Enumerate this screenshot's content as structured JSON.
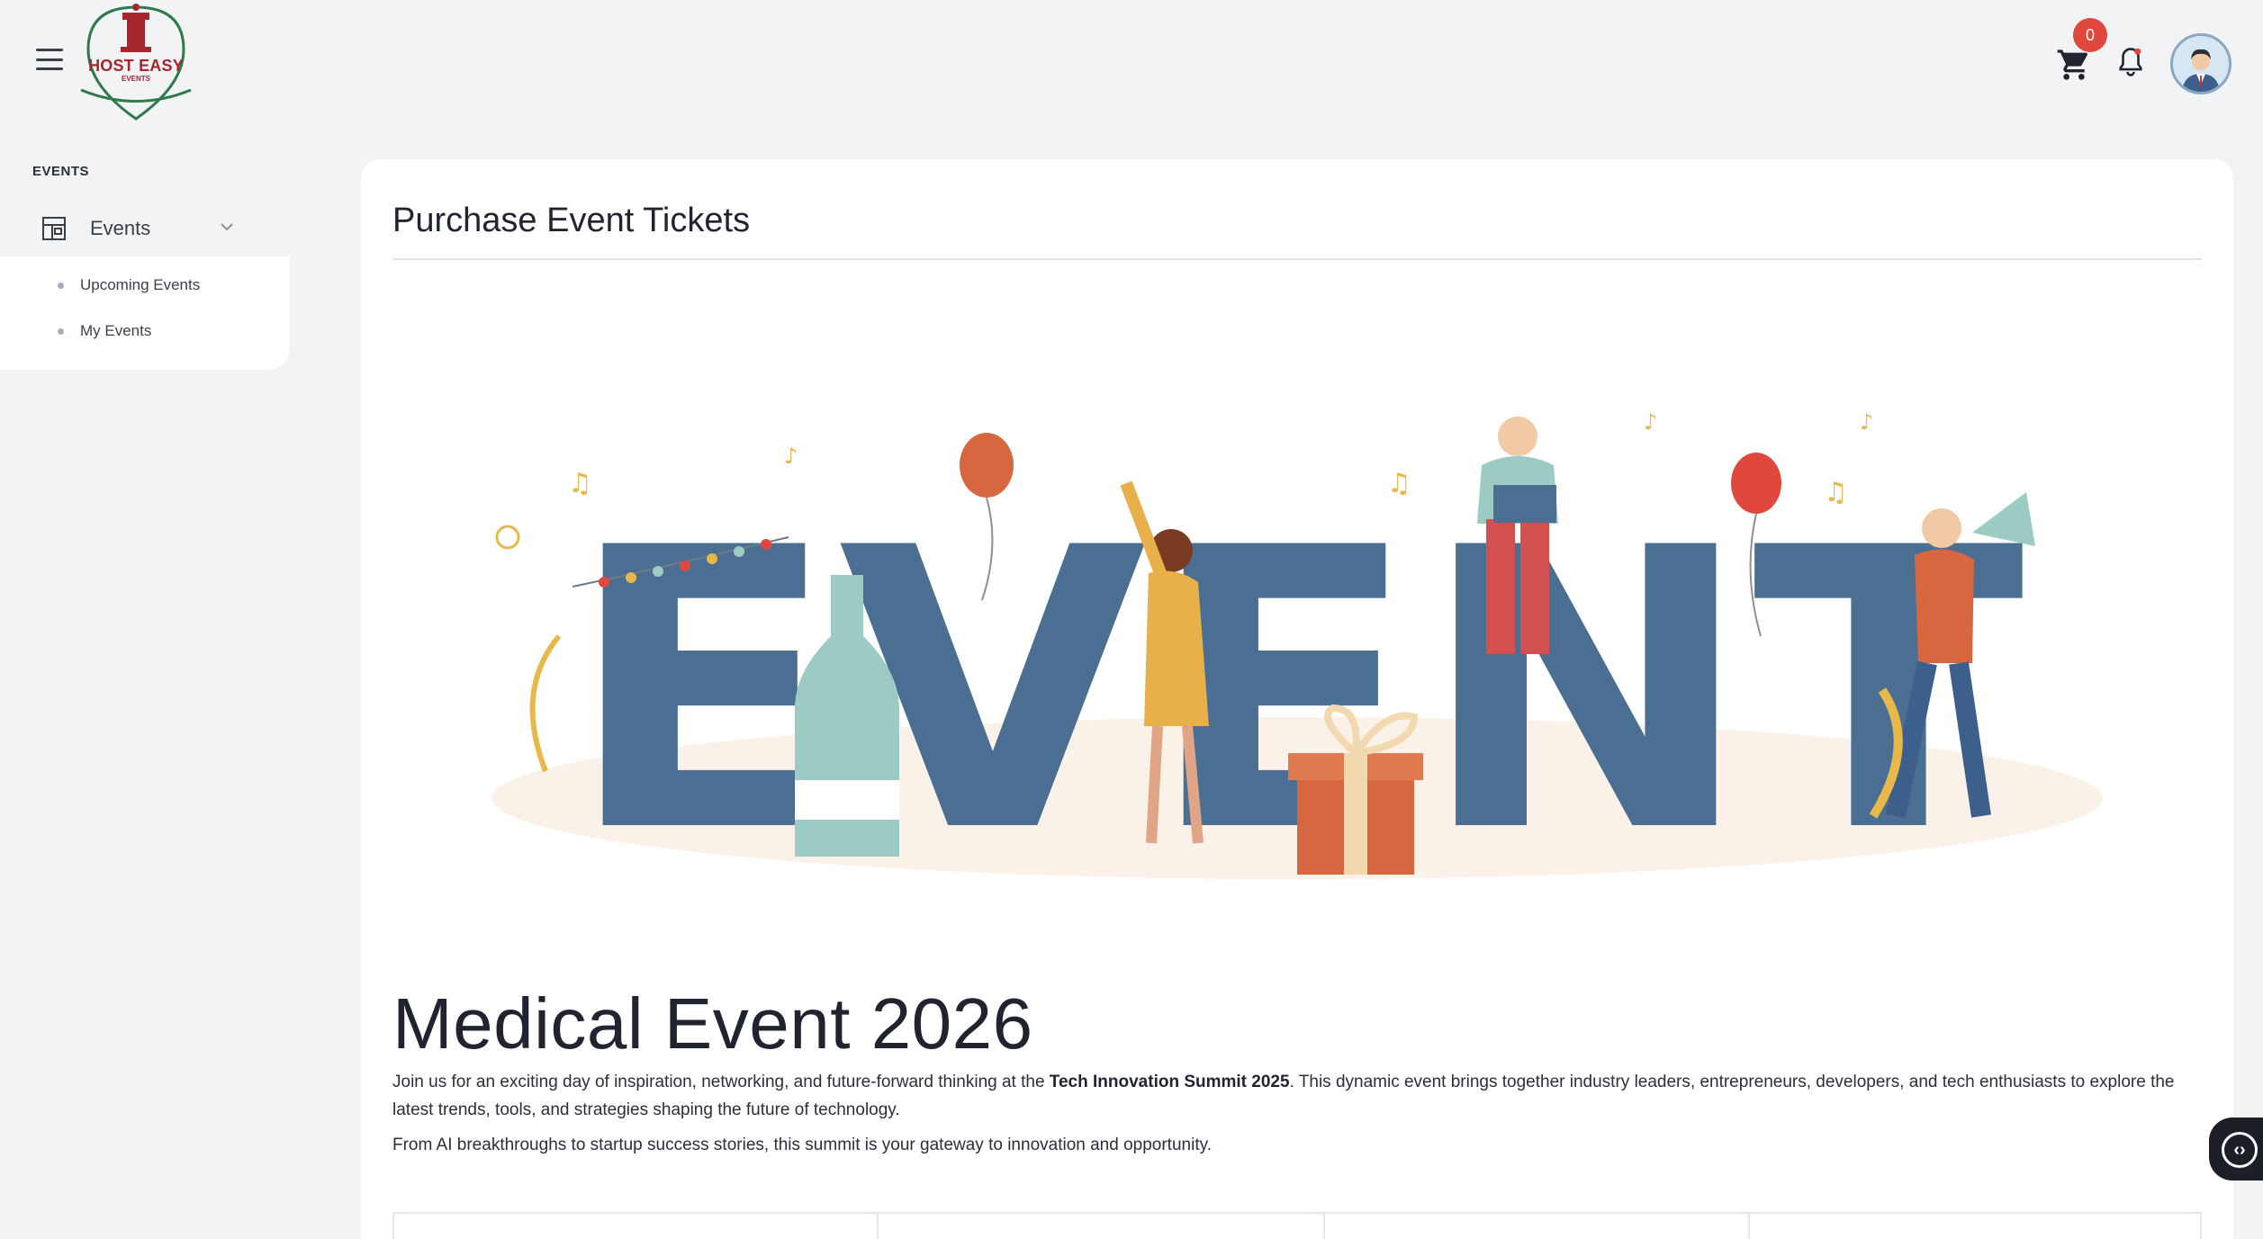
{
  "header": {
    "logo": {
      "title": "HOST EASY",
      "subtitle": "EVENTS"
    },
    "cart_count": "0"
  },
  "sidebar": {
    "section_label": "EVENTS",
    "events_menu": {
      "label": "Events",
      "items": [
        {
          "label": "Upcoming Events"
        },
        {
          "label": "My Events"
        }
      ]
    }
  },
  "main": {
    "page_title": "Purchase Event Tickets",
    "hero_letters": "EVENT",
    "event": {
      "title": "Medical Event 2026",
      "desc_before": "Join us for an exciting day of inspiration, networking, and future-forward thinking at the ",
      "desc_bold": "Tech Innovation Summit 2025",
      "desc_after": ". This dynamic event brings together industry leaders, entrepreneurs, developers, and tech enthusiasts to explore the latest trends, tools, and strategies shaping the future of technology.",
      "desc_2": "From AI breakthroughs to startup success stories, this summit is your gateway to innovation and opportunity."
    }
  },
  "colors": {
    "background": "#f2f3f5",
    "card": "#ffffff",
    "brand_red": "#a6262e",
    "badge_red": "#e0483e",
    "hero_letters": "#4b6f93"
  }
}
